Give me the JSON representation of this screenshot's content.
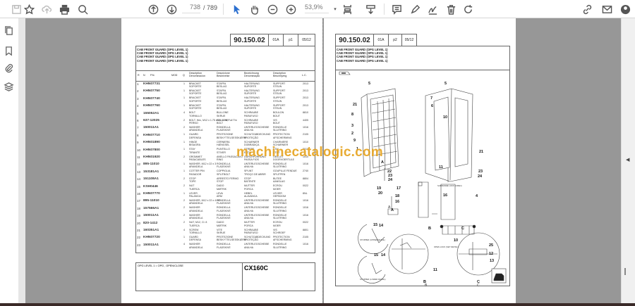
{
  "toolbar": {
    "current_page": "738",
    "total_pages": "/ 789",
    "zoom": "53,9%",
    "icons": [
      "save-icon",
      "bookmark-star-icon",
      "upload-cloud-icon",
      "print-icon",
      "zoom-search-icon",
      "previous-page-icon",
      "next-page-icon",
      "select-cursor-icon",
      "hand-tool-icon",
      "zoom-out-icon",
      "zoom-in-icon",
      "page-fit-icon",
      "scroll-mode-icon",
      "comment-icon",
      "highlight-pen-icon",
      "sign-icon",
      "delete-icon",
      "rotate-icon",
      "share-link-icon",
      "email-icon",
      "account-icon"
    ]
  },
  "sidebar": {
    "icons": [
      "pages-icon",
      "bookmarks-icon",
      "attachments-icon",
      "layers-icon"
    ]
  },
  "watermark": "machinecatalogic.com",
  "left_page": {
    "doc_no": "90.150.02",
    "rev": "01A",
    "page": "p1",
    "date": "05/12",
    "titles": [
      "CAB FRONT GUARD (OPG LEVEL 1)",
      "CAB FRONT GUARD (OPG LEVEL 1)",
      "CAB FRONT GUARD (OPG LEVEL 1)",
      "CAB FRONT GUARD (OPG LEVEL 1)"
    ],
    "headers": {
      "r": "R",
      "n": "N",
      "pn": "P.N.",
      "mod": "MOD",
      "q": "Q",
      "c1": "Description\nDenominacion",
      "c2": "Descrizione\nBeskrivelse",
      "c3": "Bezeichnung\nDenominação",
      "c4": "Description\nBeschrijving",
      "lc": "L.C."
    },
    "rows": [
      [
        "1",
        "KHN07731",
        "1",
        "BRACKET",
        "SOPORTE",
        "STAFFA",
        "BESLAG",
        "HALTERUNG",
        "SUPORTE",
        "SUPPORT",
        "STEUN",
        "2013"
      ],
      [
        "2",
        "KHN07750",
        "1",
        "BRACKET",
        "SOPORTE",
        "STAFFA",
        "BESLAG",
        "HALTERUNG",
        "SUPORTE",
        "SUPPORT",
        "STEUN",
        "2013"
      ],
      [
        "3",
        "KHN07740",
        "1",
        "BRACKET",
        "SOPORTE",
        "STAFFA",
        "BESLAG",
        "HALTERUNG",
        "SUPORTE",
        "SUPPORT",
        "STEUN",
        "2013"
      ],
      [
        "4",
        "KHN07760",
        "1",
        "BRACKET",
        "SOPORTE",
        "STAFFA",
        "BESLAG",
        "HALTERUNG",
        "SUPORTE",
        "SUPPORT",
        "STEUN",
        "2013"
      ],
      [
        "5",
        "155052A1",
        "4",
        "BOLT",
        "TORNILLO",
        "BULLONE",
        "SKRUE",
        "SCHRAUBE",
        "PARAFUSO",
        "BOULON",
        "BOUT",
        "8810"
      ],
      [
        "6",
        "637-12025",
        "2",
        "BOLT, Hex, M12 x 1.75 x 25, 10.9, Full Thr",
        "PERNO",
        "BULLONE",
        "BOLT",
        "SCHRAUBE",
        "PARAFUSO",
        "VIS",
        "BOUT",
        "4405"
      ],
      [
        "7",
        "150011A1",
        "2",
        "WASHER",
        "ARANDELA",
        "RONDELLA",
        "FLADSKIVE",
        "UNTERLEGSCHEIBE",
        "ANILHA",
        "RONDELLE",
        "SLUITRING",
        "1016"
      ],
      [
        "8",
        "KHN07710",
        "1",
        "GUARD",
        "DEFENSA",
        "PROTEZIONE",
        "BESKYTTELSESSKÆRM",
        "SCHUTZABDECKUNG",
        "PROTEÇÃO",
        "PROTECTION",
        "AFSCHERMING",
        "2105"
      ],
      [
        "9",
        "KHN01890",
        "1",
        "HINGE",
        "BISAGRA",
        "CERNIERA",
        "HÆNGSEL",
        "SCHARNIER",
        "DOBRADIÇA",
        "CHARNIERE",
        "SCHARNIER",
        "1010"
      ],
      [
        "10",
        "KHN07800",
        "1",
        "STAY",
        "TIRANTE",
        "PUNTELLO",
        "STIVER",
        "STREBE",
        "ESTAI",
        "ETAI",
        "STUT",
        "2013"
      ],
      [
        "11",
        "KHN01920",
        "2",
        "GROMMET",
        "PASACABLES",
        "ANELLO PASSACAVO",
        "RING",
        "DURCHFÜHRUNG",
        "PASSA FIOS",
        "OEILLET",
        "DOORVOERTULE",
        "1010"
      ],
      [
        "12",
        "895-11010",
        "1",
        "WASHER, M12 x 22 x 3",
        "ARANDELA",
        "RONDELLA",
        "FLADSKIVE",
        "UNTERLEGSCHEIBE",
        "ANILHA",
        "RONDELLE",
        "SLUITRING",
        "1016"
      ],
      [
        "13",
        "153181A1",
        "1",
        "COTTER PIN",
        "PASADOR",
        "COPPIGLIA",
        "SPLITBOLT",
        "SPLINT",
        "TROÇO DE ABRIR",
        "GOUPILLE FENDUE",
        "SPLITPEN",
        "2740"
      ],
      [
        "14",
        "151108A1",
        "2",
        "STOP",
        "TOPE",
        "ARRESTO FERMO",
        "STOP",
        "STOP",
        "BATENTE",
        "BUTEE",
        "AANSLAG",
        "8804"
      ],
      [
        "15",
        "KSH0446",
        "2",
        "NUT",
        "TUERCA",
        "DADO",
        "MØTRIK",
        "MUTTER",
        "PORCA",
        "ECROU",
        "MOER",
        "0022"
      ],
      [
        "16",
        "KHN07770",
        "1",
        "LEVER",
        "PALANCA",
        "LEVA",
        "ARM",
        "HEBEL",
        "ALAVANCA",
        "LEVIER",
        "HEFBOOM",
        "8NL"
      ],
      [
        "17",
        "895-11010",
        "2",
        "WASHER, M12 x 22 x 4 HT",
        "ARANDELA",
        "RONDELLA",
        "FLADSKIVE",
        "UNTERLEGSCHEIBE",
        "ANILHA",
        "RONDELLE",
        "SLUITRING",
        "1016"
      ],
      [
        "18",
        "157566A1",
        "2",
        "WASHER",
        "ARANDELA",
        "RONDELLA",
        "FLADSKIVE",
        "UNTERLEGSCHEIBE",
        "ANILHA",
        "RONDELLE",
        "SLUITRING",
        "1016"
      ],
      [
        "19",
        "150011A1",
        "2",
        "WASHER",
        "ARANDELA",
        "RONDELLA",
        "FLADSKIVE",
        "UNTERLEGSCHEIBE",
        "ANILHA",
        "RONDELLE",
        "SLUITRING",
        "1016"
      ],
      [
        "20",
        "820-1412",
        "2",
        "NUT, M12, Cl. 8",
        "TUERCA",
        "DADO",
        "MØTRIK",
        "MUTTER",
        "PORCA",
        "ECROU",
        "MOER",
        "0022"
      ],
      [
        "21",
        "160351A1",
        "4",
        "SCREW",
        "TORNILLO",
        "VITE",
        "SKRUE",
        "SCHRAUBE",
        "PARAFUSO",
        "VIS",
        "SCHROEF",
        "8801"
      ],
      [
        "22",
        "KHN07720",
        "1",
        "GUARD",
        "DEFENSA",
        "PROTEZIONE",
        "BESKYTTELSESSKÆRM",
        "SCHUTZABDECKUNG",
        "PROTEÇÃO",
        "PROTECTION",
        "AFSCHERMING",
        "2105"
      ],
      [
        "23",
        "150011A1",
        "4",
        "WASHER",
        "ARANDELA",
        "RONDELLA",
        "FLADSKIVE",
        "UNTERLEGSCHEIBE",
        "ANILHA",
        "RONDELLE",
        "SLUITRING",
        "1016"
      ]
    ],
    "footer_note": "OPG LEVEL 1 = OPG , OPEN/CLOSE",
    "model": "CX160C"
  },
  "right_page": {
    "doc_no": "90.150.02",
    "rev": "01A",
    "page": "p2",
    "date": "05/12",
    "titles": [
      "CAB FRONT GUARD (OPG LEVEL 1)",
      "CAB FRONT GUARD (OPG LEVEL 1)",
      "CAB FRONT GUARD (OPG LEVEL 1)",
      "CAB FRONT GUARD (OPG LEVEL 1)"
    ],
    "callouts": [
      "5",
      "21",
      "8",
      "3",
      "2",
      "9",
      "1",
      "22",
      "23",
      "24",
      "A",
      "5",
      "7",
      "6",
      "10",
      "11",
      "21",
      "23",
      "24",
      "19",
      "20",
      "17",
      "18",
      "16",
      "A",
      "16",
      "4",
      "15",
      "14",
      "B",
      "C",
      "10",
      "15",
      "14",
      "11",
      "B",
      "25",
      "12",
      "13",
      "C"
    ],
    "captions": [
      "A",
      "B",
      "C",
      "SUBFRAME LOCK (OPEN)",
      "STOPPER (UPPER DETAIL)",
      "OPEN LOCK (SET DETAIL)",
      "STOPPER (LOWER DETAIL)"
    ]
  }
}
